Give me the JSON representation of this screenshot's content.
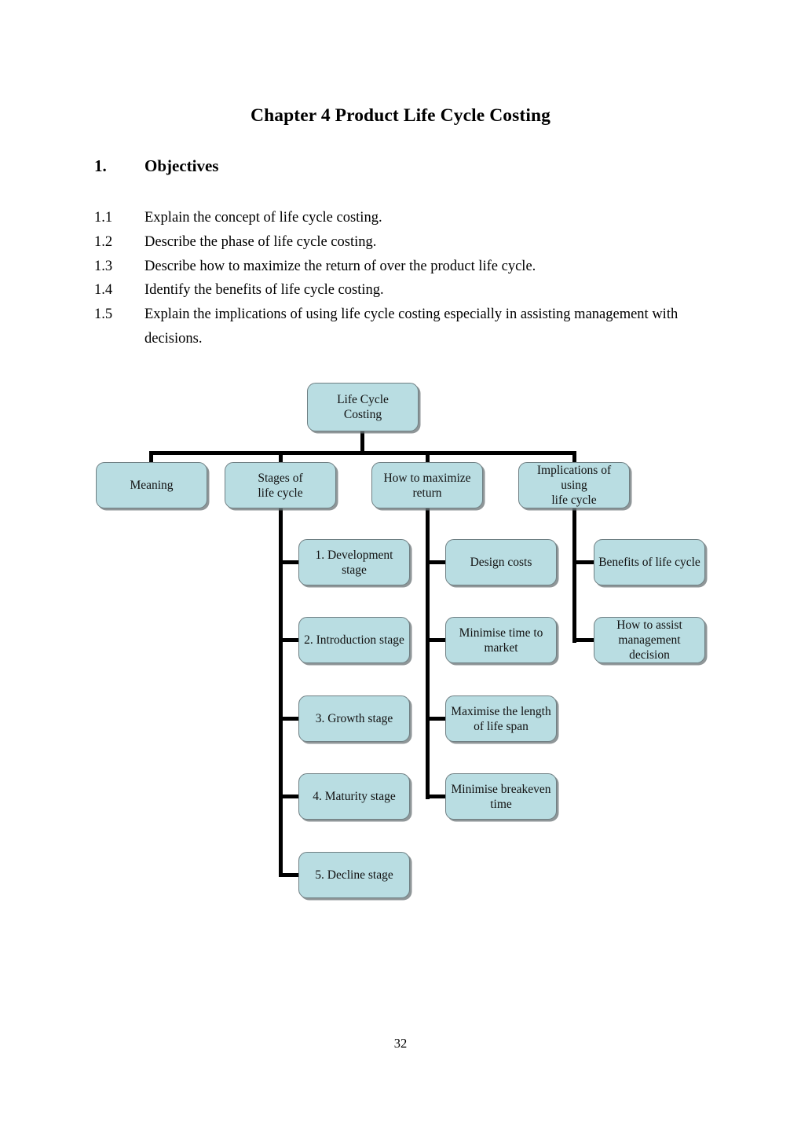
{
  "document": {
    "title": "Chapter 4 Product Life Cycle Costing",
    "page_number": "32",
    "section": {
      "number": "1.",
      "heading": "Objectives"
    },
    "objectives": [
      {
        "number": "1.1",
        "text": "Explain the concept of life cycle costing."
      },
      {
        "number": "1.2",
        "text": "Describe the phase of life cycle costing."
      },
      {
        "number": "1.3",
        "text": "Describe how to maximize the return of over the product life cycle."
      },
      {
        "number": "1.4",
        "text": "Identify the benefits of life cycle costing."
      },
      {
        "number": "1.5",
        "text": "Explain the implications of using life cycle costing especially in assisting management with decisions."
      }
    ]
  },
  "diagram": {
    "node_fill_color": "#b9dde2",
    "node_border_color": "#6f7f83",
    "connector_color": "#000000",
    "root": {
      "label": "Life Cycle\nCosting"
    },
    "level2": [
      {
        "label": "Meaning"
      },
      {
        "label": "Stages of\nlife cycle"
      },
      {
        "label": "How to maximize\nreturn"
      },
      {
        "label": "Implications of using\nlife cycle"
      }
    ],
    "stages_children": [
      {
        "label": "1. Development stage"
      },
      {
        "label": "2. Introduction stage"
      },
      {
        "label": "3. Growth stage"
      },
      {
        "label": "4. Maturity stage"
      },
      {
        "label": "5. Decline stage"
      }
    ],
    "maximize_children": [
      {
        "label": "Design costs"
      },
      {
        "label": "Minimise time to\nmarket"
      },
      {
        "label": "Maximise the length\nof life span"
      },
      {
        "label": "Minimise breakeven\ntime"
      }
    ],
    "implications_children": [
      {
        "label": "Benefits of life cycle"
      },
      {
        "label": "How to assist\nmanagement decision"
      }
    ]
  }
}
